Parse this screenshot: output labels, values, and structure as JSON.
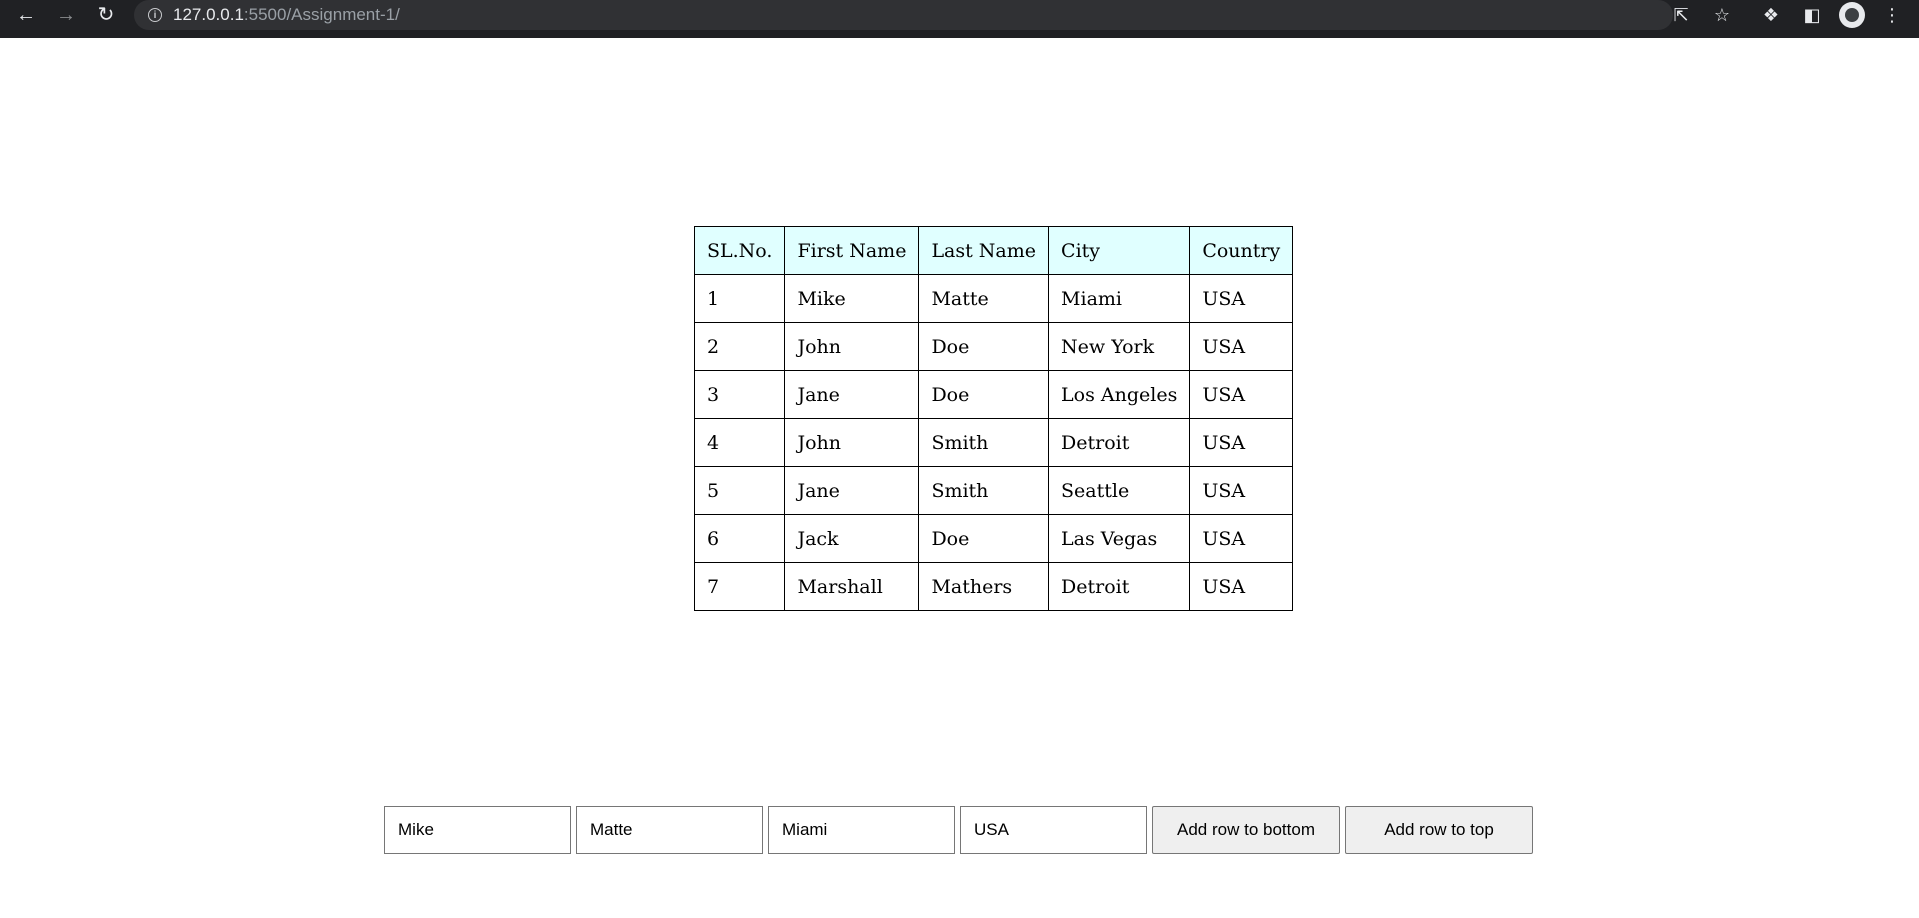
{
  "browser": {
    "url_host": "127.0.0.1",
    "url_rest": ":5500/Assignment-1/"
  },
  "table": {
    "headers": [
      "SL.No.",
      "First Name",
      "Last Name",
      "City",
      "Country"
    ],
    "rows": [
      [
        "1",
        "Mike",
        "Matte",
        "Miami",
        "USA"
      ],
      [
        "2",
        "John",
        "Doe",
        "New York",
        "USA"
      ],
      [
        "3",
        "Jane",
        "Doe",
        "Los Angeles",
        "USA"
      ],
      [
        "4",
        "John",
        "Smith",
        "Detroit",
        "USA"
      ],
      [
        "5",
        "Jane",
        "Smith",
        "Seattle",
        "USA"
      ],
      [
        "6",
        "Jack",
        "Doe",
        "Las Vegas",
        "USA"
      ],
      [
        "7",
        "Marshall",
        "Mathers",
        "Detroit",
        "USA"
      ]
    ]
  },
  "form": {
    "first_name_value": "Mike",
    "last_name_value": "Matte",
    "city_value": "Miami",
    "country_value": "USA",
    "add_bottom_label": "Add row to bottom",
    "add_top_label": "Add row to top"
  },
  "colors": {
    "header_bg": "#e0ffff",
    "browser_bar": "#202124"
  }
}
